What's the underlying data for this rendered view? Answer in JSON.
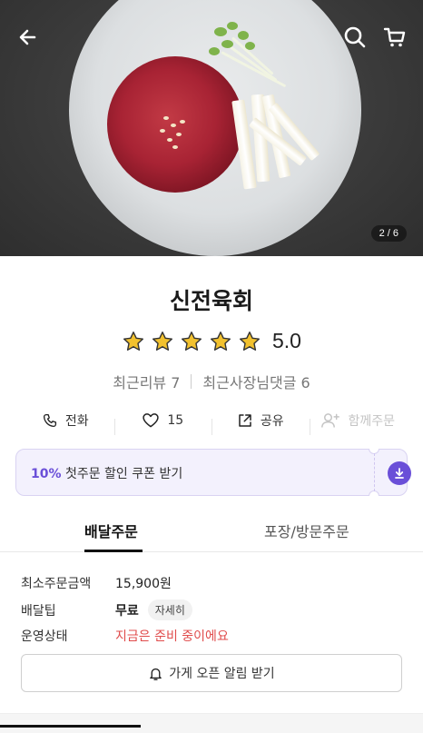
{
  "hero": {
    "counter": "2 / 6"
  },
  "store": {
    "name": "신전육회",
    "rating_value": 5.0,
    "rating_text": "5.0",
    "stars": 5
  },
  "reviews": {
    "recent_reviews": "최근리뷰 7",
    "owner_replies": "최근사장님댓글 6"
  },
  "actions": {
    "call": "전화",
    "likes": "15",
    "share": "공유",
    "group_order": "함께주문"
  },
  "coupon": {
    "highlight": "10%",
    "text": " 첫주문 할인 쿠폰 받기"
  },
  "tabs": {
    "delivery": "배달주문",
    "pickup": "포장/방문주문"
  },
  "info": {
    "min_order_label": "최소주문금액",
    "min_order_value": "15,900원",
    "delivery_tip_label": "배달팁",
    "delivery_tip_value": "무료",
    "details": "자세히",
    "status_label": "운영상태",
    "status_value": "지금은 준비 중이에요"
  },
  "alarm_button": "가게 오픈 알림 받기",
  "colors": {
    "accent": "#6a4fd8",
    "warn": "#e04c4c",
    "star": "#f2c12e"
  },
  "icons": [
    "back-arrow-icon",
    "search-icon",
    "cart-icon",
    "star-icon",
    "phone-icon",
    "heart-icon",
    "share-icon",
    "add-person-icon",
    "download-icon",
    "bell-icon"
  ]
}
